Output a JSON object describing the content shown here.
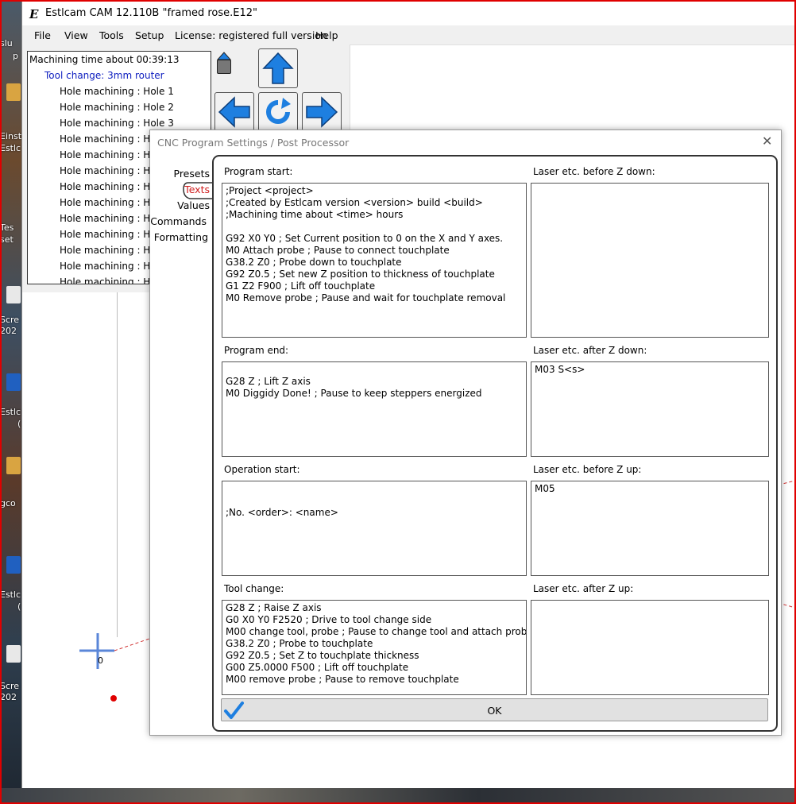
{
  "window": {
    "title": "Estlcam CAM 12.110B \"framed rose.E12\"",
    "menu": [
      "File",
      "View",
      "Tools",
      "Setup",
      "License: registered full version",
      "Help"
    ]
  },
  "tree": {
    "header": "Machining time about 00:39:13",
    "tool_change": "Tool change: 3mm router",
    "items": [
      "Hole machining : Hole 1",
      "Hole machining : Hole 2",
      "Hole machining : Hole 3",
      "Hole machining : Hole",
      "Hole machining : Hole",
      "Hole machining : Hole",
      "Hole machining : Hole",
      "Hole machining : Hole",
      "Hole machining : Hole",
      "Hole machining : Hole",
      "Hole machining : Hole",
      "Hole machining : Hole",
      "Hole machining : Hole"
    ]
  },
  "canvas": {
    "origin_label": "0"
  },
  "desktop": [
    "slu",
    "p",
    "Einst",
    "Estlc",
    "Tes",
    "set",
    "Scre",
    "202",
    "Estlc",
    "(",
    "gco",
    "Estlc",
    "(",
    "Scre",
    "202"
  ],
  "dialog": {
    "title": "CNC Program Settings / Post Processor",
    "nav": [
      "Presets",
      "Texts",
      "Values",
      "Commands",
      "Formatting"
    ],
    "active_nav": "Texts",
    "sections": {
      "program_start": {
        "label": "Program start:",
        "text": ";Project <project>\n;Created by Estlcam version <version> build <build>\n;Machining time about <time> hours\n\nG92 X0 Y0 ; Set Current position to 0 on the X and Y axes.\nM0 Attach probe ; Pause to connect touchplate\nG38.2 Z0 ; Probe down to touchplate\nG92 Z0.5 ; Set new Z position to thickness of touchplate\nG1 Z2 F900 ; Lift off touchplate\nM0 Remove probe ; Pause and wait for touchplate removal"
      },
      "laser_before_z_down": {
        "label": "Laser etc. before Z down:",
        "text": ""
      },
      "program_end": {
        "label": "Program end:",
        "text": "\nG28 Z ; Lift Z axis\nM0 Diggidy Done! ; Pause to keep steppers energized"
      },
      "laser_after_z_down": {
        "label": "Laser etc. after Z down:",
        "text": "M03 S<s>"
      },
      "operation_start": {
        "label": "Operation start:",
        "text": "\n\n;No. <order>: <name>"
      },
      "laser_before_z_up": {
        "label": "Laser etc. before Z up:",
        "text": "M05"
      },
      "tool_change": {
        "label": "Tool change:",
        "text": "G28 Z ; Raise Z axis\nG0 X0 Y0 F2520 ; Drive to tool change side\nM00 change tool, probe ; Pause to change tool and attach probe.\nG38.2 Z0 ; Probe to touchplate\nG92 Z0.5 ; Set Z to touchplate thickness\nG00 Z5.0000 F500 ; Lift off touchplate\nM00 remove probe ; Pause to remove touchplate"
      },
      "laser_after_z_up": {
        "label": "Laser etc. after Z up:",
        "text": ""
      }
    },
    "ok_label": "OK"
  },
  "colors": {
    "accent_blue": "#1e7fe0",
    "active_nav_red": "#d02020",
    "tool_change_blue": "#1020c0",
    "highlight_red": "#e00000"
  }
}
